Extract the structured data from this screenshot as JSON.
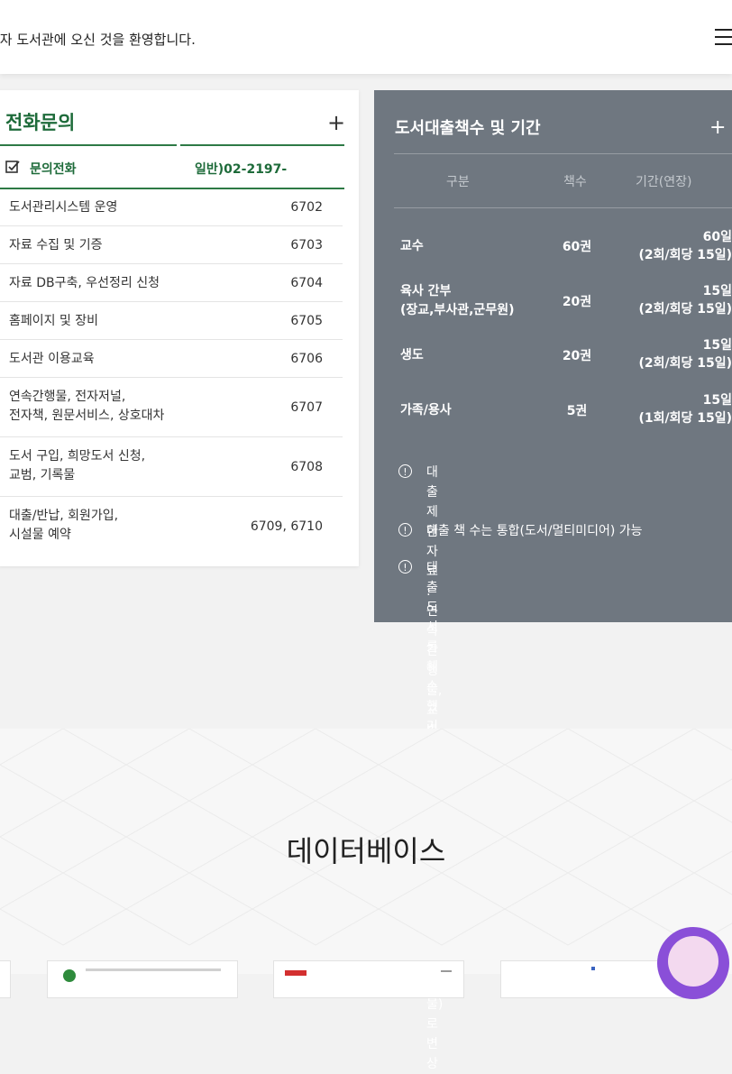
{
  "header": {
    "welcome_text": "전자 도서관에 오신 것을 환영합니다."
  },
  "phone_panel": {
    "title": "전화문의",
    "plus_label": "+",
    "sub_label": "문의전화",
    "sub_value": "일반)02-2197-",
    "rows": [
      {
        "label": "도서관리시스템 운영",
        "value": "6702"
      },
      {
        "label": "자료 수집 및 기증",
        "value": "6703"
      },
      {
        "label": "자료 DB구축, 우선정리 신청",
        "value": "6704"
      },
      {
        "label": "홈페이지 및 장비",
        "value": "6705"
      },
      {
        "label": "도서관 이용교육",
        "value": "6706"
      },
      {
        "label": "연속간행물, 전자저널,\n전자책, 원문서비스, 상호대차",
        "value": "6707"
      },
      {
        "label": "도서 구입, 희망도서 신청,\n교범, 기록물",
        "value": "6708"
      },
      {
        "label": "대출/반납, 회원가입,\n시설물 예약",
        "value": "6709, 6710"
      }
    ]
  },
  "loan_panel": {
    "title": "도서대출책수 및 기간",
    "plus_label": "+",
    "headers": [
      "구분",
      "책수",
      "기간(연장)"
    ],
    "rows": [
      {
        "category": "교수",
        "count": "60권",
        "period": "60일\n(2회/회당 15일)"
      },
      {
        "category": "육사 간부\n(장교,부사관,군무원)",
        "count": "20권",
        "period": "15일\n(2회/회당 15일)"
      },
      {
        "category": "생도",
        "count": "20권",
        "period": "15일\n(2회/회당 15일)"
      },
      {
        "category": "가족/용사",
        "count": "5권",
        "period": "15일\n(1회/회당 15일)"
      }
    ],
    "notes": [
      "대출 제한자료 : 연속간행물, 교범, 학교 존안 자료,\n특별취급자료 등",
      "대출 책 수는 통합(도서/멀티미디어) 가능",
      "대출 도서를 훼손했거나 분실한 경우에는\n동일 도서(현물)로 변상"
    ],
    "note_icon": "!"
  },
  "database": {
    "title": "데이터베이스",
    "logos": [
      "ebsco-military-government-collection-logo",
      "database-logo-2",
      "database-logo-3"
    ]
  },
  "colors": {
    "accent_green": "#1e6b3a",
    "loan_panel_bg": "#6f7780",
    "page_bg": "#f2f2f2"
  },
  "icons": {
    "menu": "hamburger-menu-icon",
    "checkbox": "checkbox-check-icon",
    "note": "info-circle-icon"
  }
}
